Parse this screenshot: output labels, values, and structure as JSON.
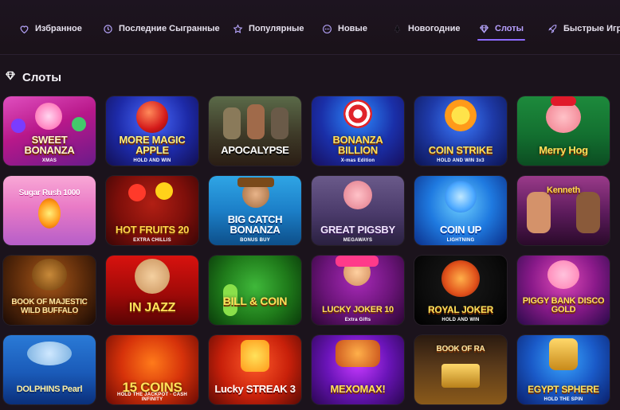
{
  "nav": {
    "tabs": [
      {
        "label": "Избранное",
        "icon": "heart-icon",
        "active": false
      },
      {
        "label": "Последние Сыгранные",
        "icon": "history-icon",
        "active": false
      },
      {
        "label": "Популярные",
        "icon": "star-icon",
        "active": false
      },
      {
        "label": "Новые",
        "icon": "new-icon",
        "active": false
      },
      {
        "label": "Новогодние",
        "icon": "tree-icon",
        "active": false
      },
      {
        "label": "Слоты",
        "icon": "diamond-icon",
        "active": true
      },
      {
        "label": "Быстрые Игры",
        "icon": "rocket-icon",
        "active": false
      }
    ]
  },
  "section": {
    "title": "Слоты",
    "icon": "diamond-icon"
  },
  "colors": {
    "accent": "#8d6bff",
    "background": "#1b131c"
  },
  "games": [
    {
      "title": "SWEET BONANZA",
      "subtitle": "XMAS"
    },
    {
      "title": "MORE MAGIC APPLE",
      "subtitle": "HOLD AND WIN"
    },
    {
      "title": "APOCALYPSE",
      "subtitle": ""
    },
    {
      "title": "BONANZA BILLION",
      "subtitle": "X-mas Edition"
    },
    {
      "title": "COIN STRIKE",
      "subtitle": "HOLD AND WIN 3x3"
    },
    {
      "title": "Merry Hog",
      "subtitle": ""
    },
    {
      "title": "Sugar Rush 1000",
      "subtitle": ""
    },
    {
      "title": "HOT FRUITS 20",
      "subtitle": "EXTRA CHILLIS"
    },
    {
      "title": "BIG CATCH BONANZA",
      "subtitle": "BONUS BUY"
    },
    {
      "title": "GREAT PIGSBY",
      "subtitle": "MEGAWAYS"
    },
    {
      "title": "COIN UP",
      "subtitle": "LIGHTNING"
    },
    {
      "title": "Kenneth",
      "subtitle": ""
    },
    {
      "title": "BOOK OF MAJESTIC WILD BUFFALO",
      "subtitle": ""
    },
    {
      "title": "IN JAZZ",
      "subtitle": ""
    },
    {
      "title": "BILL & COIN",
      "subtitle": ""
    },
    {
      "title": "LUCKY JOKER 10",
      "subtitle": "Extra Gifts"
    },
    {
      "title": "ROYAL JOKER",
      "subtitle": "HOLD AND WIN"
    },
    {
      "title": "PIGGY BANK DISCO GOLD",
      "subtitle": ""
    },
    {
      "title": "DOLPHINS Pearl",
      "subtitle": ""
    },
    {
      "title": "15 COINS",
      "subtitle": "HOLD THE JACKPOT · CASH INFINITY"
    },
    {
      "title": "Lucky STREAK 3",
      "subtitle": ""
    },
    {
      "title": "MEXOMAX!",
      "subtitle": ""
    },
    {
      "title": "BOOK OF RA",
      "subtitle": ""
    },
    {
      "title": "EGYPT SPHERE",
      "subtitle": "HOLD THE SPIN"
    }
  ]
}
